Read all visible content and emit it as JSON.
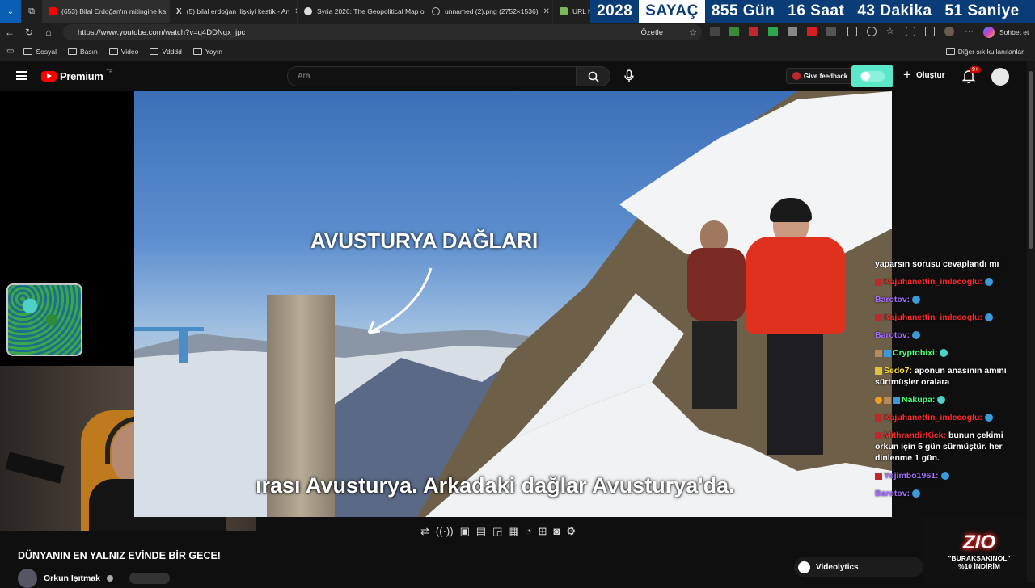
{
  "tabs": [
    {
      "title": "(653) Bilal Erdoğan'ın mitingine ka",
      "favicon_color": "#ff0000"
    },
    {
      "title": "(5) bilal erdoğan ilişkiyi kestik - An",
      "favicon_color": "#ffffff"
    },
    {
      "title": "Syria 2026: The Geopolitical Map o",
      "favicon_color": "#dddddd"
    },
    {
      "title": "unnamed (2).png (2752×1536)",
      "favicon_color": "#bbbbbb"
    },
    {
      "title": "URL N",
      "favicon_color": "#7ab85a"
    }
  ],
  "counter": {
    "year": "2028",
    "label": "SAYAÇ",
    "days": "855 Gün",
    "hours": "16 Saat",
    "minutes": "43 Dakika",
    "seconds": "51 Saniye"
  },
  "url": "https://www.youtube.com/watch?v=q4DDNgx_jpc",
  "toolbar": {
    "summarize": "Özetle",
    "chat": "Sohbet et"
  },
  "bookmarks": [
    "Sosyal",
    "Basın",
    "Video",
    "Vdddd",
    "Yayın"
  ],
  "other_bookmarks": "Diğer sık kullanılanlar",
  "youtube": {
    "logo": "Premium",
    "region": "TR",
    "search_placeholder": "Ara",
    "feedback": "Give feedback",
    "create": "Oluştur",
    "notif_badge": "9+"
  },
  "video": {
    "overlay_title": "AVUSTURYA DAĞLARI",
    "subtitle": "ırası Avusturya. Arkadaki dağlar Avusturya'da."
  },
  "chat": [
    {
      "user": "",
      "text": "yaparsın sorusu cevaplandı mı",
      "color": "#ffffff"
    },
    {
      "user": "Kajuhanettin_imlecoglu:",
      "text": "",
      "color": "#ff2b2b"
    },
    {
      "user": "Barotov:",
      "text": "",
      "color": "#a66cff"
    },
    {
      "user": "Kajuhanettin_imlecoglu:",
      "text": "",
      "color": "#ff2b2b"
    },
    {
      "user": "Barotov:",
      "text": "",
      "color": "#a66cff"
    },
    {
      "user": "Cryptobixi:",
      "text": "",
      "color": "#4dff7a"
    },
    {
      "user": "Sedo7:",
      "text": "aponun anasının amını sürtmüşler oralara",
      "color": "#ffe033"
    },
    {
      "user": "Nakupa:",
      "text": "",
      "color": "#4dff7a"
    },
    {
      "user": "Kajuhanettin_imlecoglu:",
      "text": "",
      "color": "#ff2b2b"
    },
    {
      "user": "MithrandirKick:",
      "text": "bunun çekimi orkun için 5 gün sürmüştür. her dinlenme 1 gün.",
      "color": "#ff2b2b"
    },
    {
      "user": "Yojimbo1961:",
      "text": "",
      "color": "#a66cff"
    },
    {
      "user": "Barotov:",
      "text": "",
      "color": "#a66cff"
    }
  ],
  "video_title": "DÜNYANIN EN YALNIZ EVİNDE BİR GECE!",
  "channel": "Orkun Işıtmak",
  "videolytics": "Videolytics",
  "promo": {
    "brand": "ZIO",
    "code": "\"BURAKSAKINOL\"",
    "discount": "%10 İNDİRİM"
  }
}
